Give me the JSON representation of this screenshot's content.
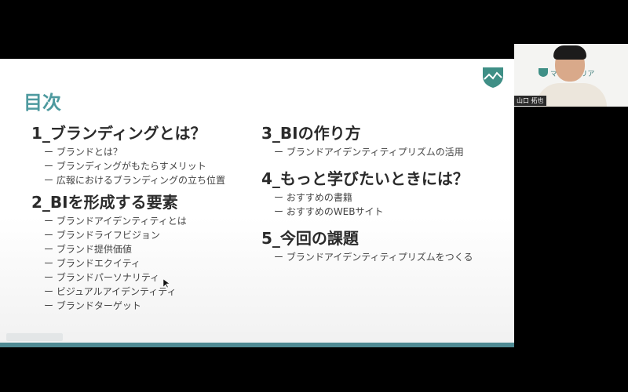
{
  "slide": {
    "title": "目次",
    "left_sections": [
      {
        "heading": "1_ブランディングとは？",
        "items": [
          "ー ブランドとは？",
          "ー ブランディングがもたらすメリット",
          "ー 広報におけるブランディングの立ち位置"
        ]
      },
      {
        "heading": "2_BIを形成する要素",
        "items": [
          "ー ブランドアイデンティティとは",
          "ー ブランドライフビジョン",
          "ー ブランド提供価値",
          "ー ブランドエクイティ",
          "ー ブランドパーソナリティ",
          "ー ビジュアルアイデンティティ",
          "ー ブランドターゲット"
        ]
      }
    ],
    "right_sections": [
      {
        "heading": "3_BIの作り方",
        "items": [
          "ー ブランドアイデンティティプリズムの活用"
        ]
      },
      {
        "heading": "4_もっと学びたいときには？",
        "items": [
          "ー おすすめの書籍",
          "ー おすすめのWEBサイト"
        ]
      },
      {
        "heading": "5_今回の課題",
        "items": [
          "ー ブランドアイデンティティプリズムをつくる"
        ]
      }
    ],
    "accent_color": "#4e9a9f"
  },
  "camera": {
    "background_text": "マー      ティリア",
    "name": "山口 拓也"
  }
}
